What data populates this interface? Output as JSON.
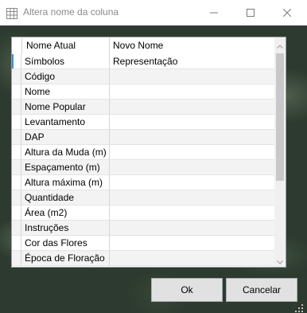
{
  "window": {
    "title": "Altera nome da coluna"
  },
  "titlebar_icons": [
    "table-icon",
    "minimize-icon",
    "maximize-icon",
    "close-icon"
  ],
  "grid": {
    "columns": [
      "Nome Atual",
      "Novo Nome"
    ],
    "rows": [
      {
        "current": "Símbolos",
        "new": "Representação"
      },
      {
        "current": "Código",
        "new": ""
      },
      {
        "current": "Nome",
        "new": ""
      },
      {
        "current": "Nome Popular",
        "new": ""
      },
      {
        "current": "Levantamento",
        "new": ""
      },
      {
        "current": "DAP",
        "new": ""
      },
      {
        "current": "Altura da Muda (m)",
        "new": ""
      },
      {
        "current": "Espaçamento (m)",
        "new": ""
      },
      {
        "current": "Altura máxima (m)",
        "new": ""
      },
      {
        "current": "Quantidade",
        "new": ""
      },
      {
        "current": "Área (m2)",
        "new": ""
      },
      {
        "current": "Instruções",
        "new": ""
      },
      {
        "current": "Cor das Flores",
        "new": ""
      },
      {
        "current": "Época de Floração",
        "new": ""
      }
    ]
  },
  "buttons": {
    "ok": "Ok",
    "cancel": "Cancelar"
  },
  "colors": {
    "selection_marker": "#3b8ed8",
    "button_face": "#e1e1e1",
    "background": "#2c3a2f"
  }
}
